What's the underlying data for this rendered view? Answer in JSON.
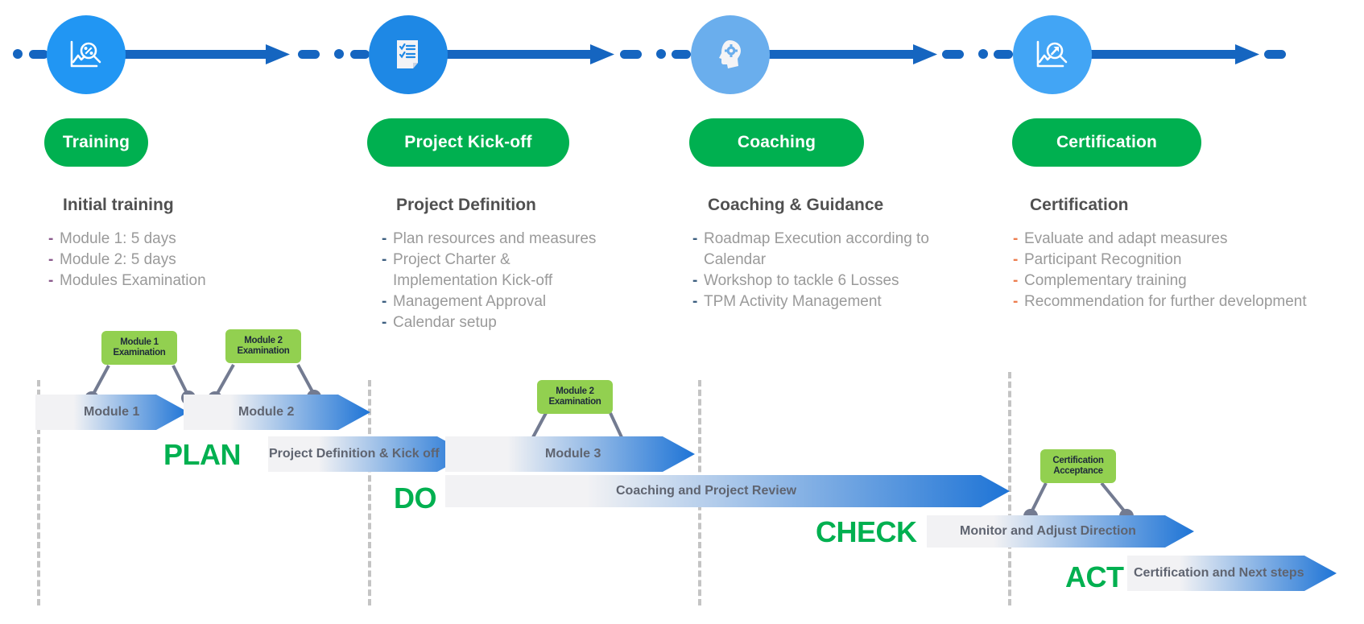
{
  "colors": {
    "timeline_blue": "#1565c0",
    "pill_green": "#00b050",
    "pdca_green": "#00b050",
    "milestone_green": "#92d050",
    "bar_gradient_start": "#f2f2f4",
    "bar_gradient_end": "#1e74d6",
    "dash_purple": "#8a5a8c",
    "dash_blue": "#3d5f80",
    "dash_orange": "#ed7d4e"
  },
  "phases": [
    {
      "icon": "chart-magnifier-percent-icon",
      "icon_color": "#2196f3",
      "pill_label": "Training",
      "title": "Initial training",
      "dash_color": "#8a5a8c",
      "items": [
        "Module 1: 5 days",
        "Module 2: 5 days",
        "Modules Examination"
      ]
    },
    {
      "icon": "checklist-document-icon",
      "icon_color": "#1e88e5",
      "pill_label": "Project Kick-off",
      "title": "Project Definition",
      "dash_color": "#3d5f80",
      "items": [
        "Plan resources and measures",
        "Project Charter &",
        "Implementation Kick-off",
        "Management Approval",
        "Calendar setup"
      ]
    },
    {
      "icon": "head-gear-icon",
      "icon_color": "#6aaeed",
      "pill_label": "Coaching",
      "title": "Coaching & Guidance",
      "dash_color": "#3d5f80",
      "items": [
        "Roadmap Execution according to",
        "Calendar",
        "Workshop to tackle 6 Losses",
        "TPM Activity Management"
      ]
    },
    {
      "icon": "chart-magnifier-arrow-icon",
      "icon_color": "#42a5f5",
      "pill_label": "Certification",
      "title": "Certification",
      "dash_color": "#ed7d4e",
      "items": [
        "Evaluate and adapt measures",
        "Participant Recognition",
        "Complementary training",
        "Recommendation for further development"
      ]
    }
  ],
  "gantt": {
    "bars": [
      {
        "label": "Module 1"
      },
      {
        "label": "Module 2"
      },
      {
        "label": "Project Definition & Kick off"
      },
      {
        "label": "Module 3"
      },
      {
        "label": "Coaching and Project Review"
      },
      {
        "label": "Monitor and Adjust Direction"
      },
      {
        "label": "Certification and Next steps"
      }
    ],
    "milestones": [
      {
        "line1": "Module 1",
        "line2": "Examination"
      },
      {
        "line1": "Module 2",
        "line2": "Examination"
      },
      {
        "line1": "Module 2",
        "line2": "Examination"
      },
      {
        "line1": "Certification",
        "line2": "Acceptance"
      }
    ],
    "pdca": [
      "PLAN",
      "DO",
      "CHECK",
      "ACT"
    ]
  }
}
